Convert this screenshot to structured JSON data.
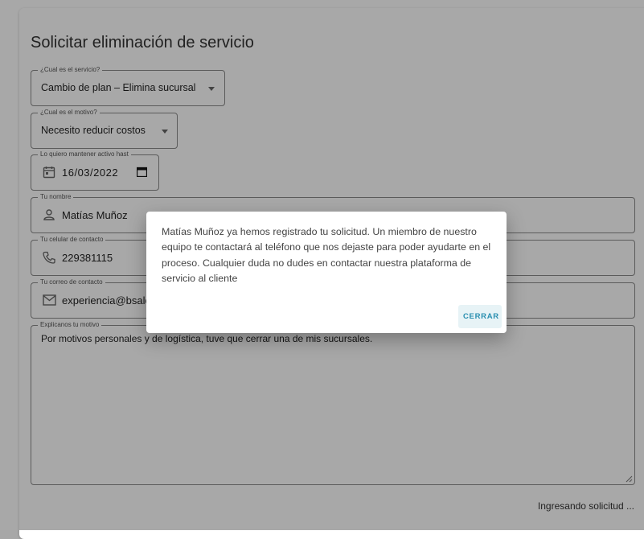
{
  "form": {
    "title": "Solicitar eliminación de servicio",
    "service": {
      "label": "¿Cual es el servicio?",
      "value": "Cambio de plan – Elimina sucursal"
    },
    "reason": {
      "label": "¿Cual es el motivo?",
      "value": "Necesito reducir costos"
    },
    "date": {
      "label": "Lo quiero mantener activo hast",
      "value": "16/03/2022"
    },
    "name": {
      "label": "Tu nombre",
      "value": "Matías Muñoz"
    },
    "phone": {
      "label": "Tu celular de contacto",
      "value": "229381115"
    },
    "email": {
      "label": "Tu correo de contacto",
      "value": "experiencia@bsale.cl"
    },
    "explanation": {
      "label": "Explicanos tu motivo",
      "value": "Por motivos personales y de logística, tuve que cerrar una de mis sucursales."
    },
    "status_text": "Ingresando solicitud ..."
  },
  "dialog": {
    "message": "Matías Muñoz ya hemos registrado tu solicitud. Un miembro de nuestro equipo te contactará al teléfono que nos dejaste para poder ayudarte en el proceso. Cualquier duda no dudes en contactar nuestra plataforma de servicio al cliente",
    "close_label": "CERRAR"
  },
  "colors": {
    "accent": "#2a8fb0",
    "button_bg": "#e7f3f6"
  },
  "icons": [
    "dropdown-caret-icon",
    "calendar-icon",
    "person-icon",
    "phone-icon",
    "mail-icon",
    "resize-handle-icon"
  ]
}
